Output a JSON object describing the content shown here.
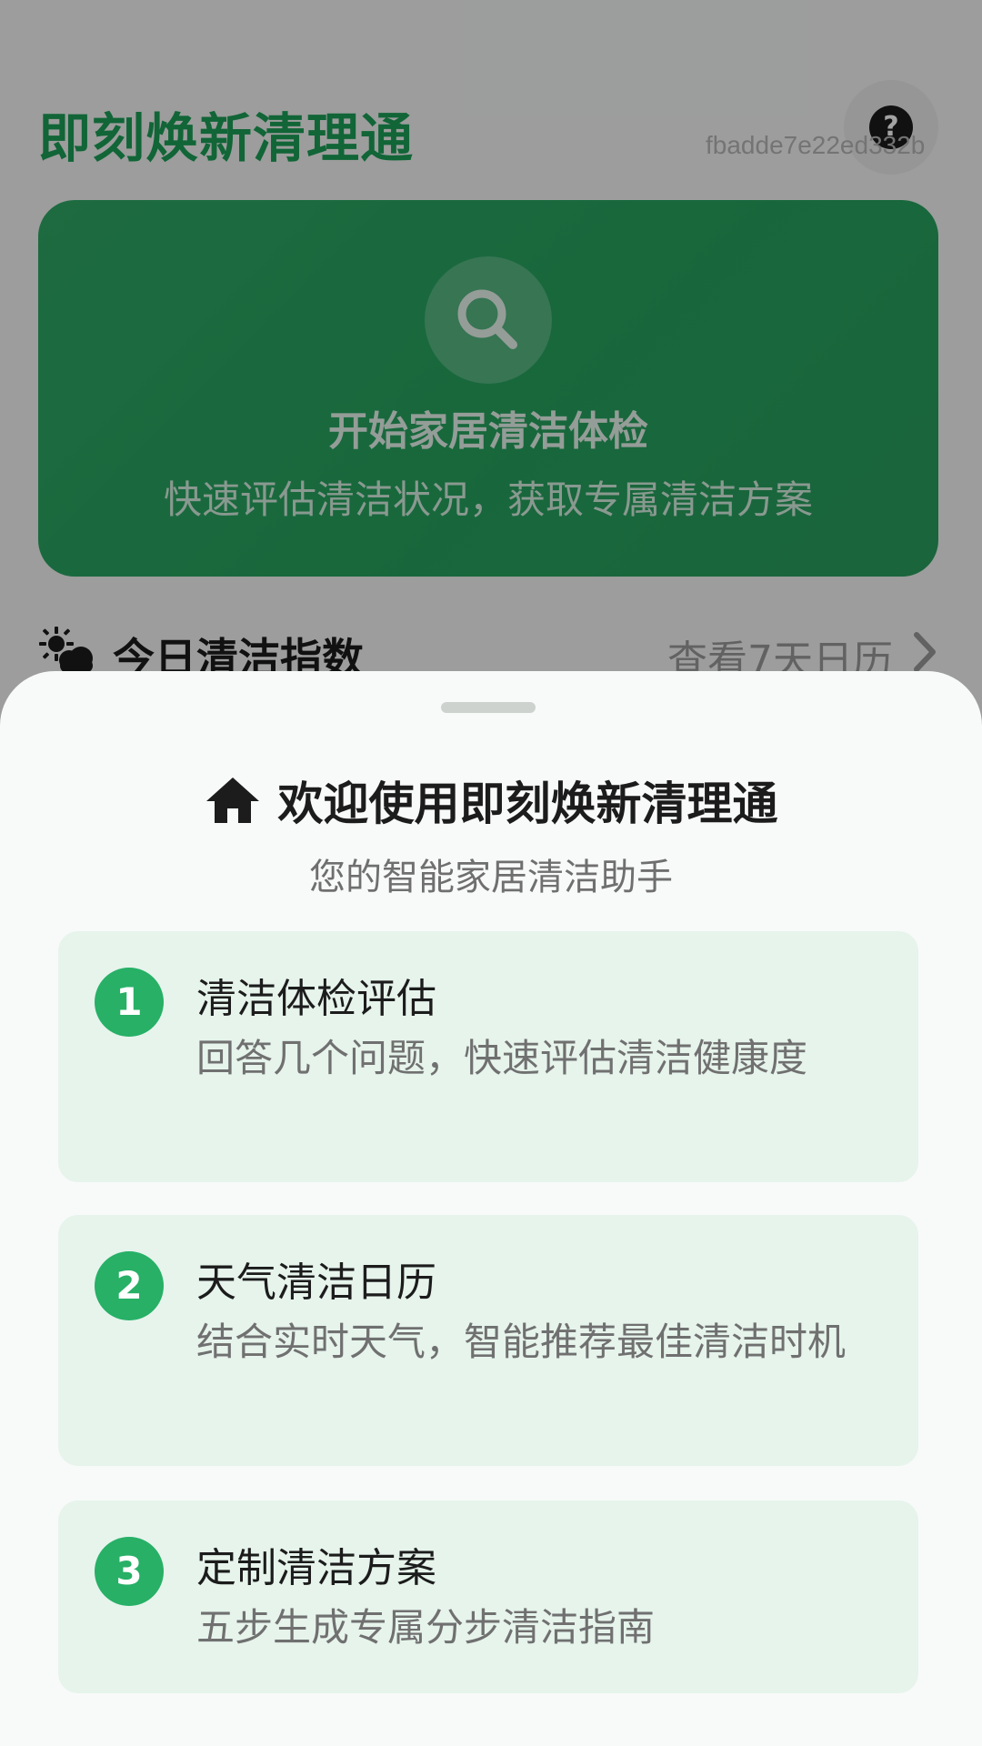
{
  "app": {
    "title": "即刻焕新清理通",
    "help_label": "?",
    "device_id": "fbadde7e22ed332b"
  },
  "hero": {
    "icon": "search-icon",
    "title": "开始家居清洁体检",
    "subtitle": "快速评估清洁状况，获取专属清洁方案"
  },
  "index": {
    "icon": "weather-sun-cloud-icon",
    "label": "今日清洁指数",
    "link": "查看7天日历"
  },
  "sheet": {
    "icon": "home-icon",
    "title": "欢迎使用即刻焕新清理通",
    "subtitle": "您的智能家居清洁助手",
    "steps": [
      {
        "num": "1",
        "title": "清洁体检评估",
        "desc": "回答几个问题，快速评估清洁健康度"
      },
      {
        "num": "2",
        "title": "天气清洁日历",
        "desc": "结合实时天气，智能推荐最佳清洁时机"
      },
      {
        "num": "3",
        "title": "定制清洁方案",
        "desc": "五步生成专属分步清洁指南"
      }
    ]
  },
  "colors": {
    "brand_green": "#1b9e57",
    "hero_green": "#2aa462",
    "step_badge": "#27b066",
    "step_card_bg": "#e6f4ec"
  }
}
